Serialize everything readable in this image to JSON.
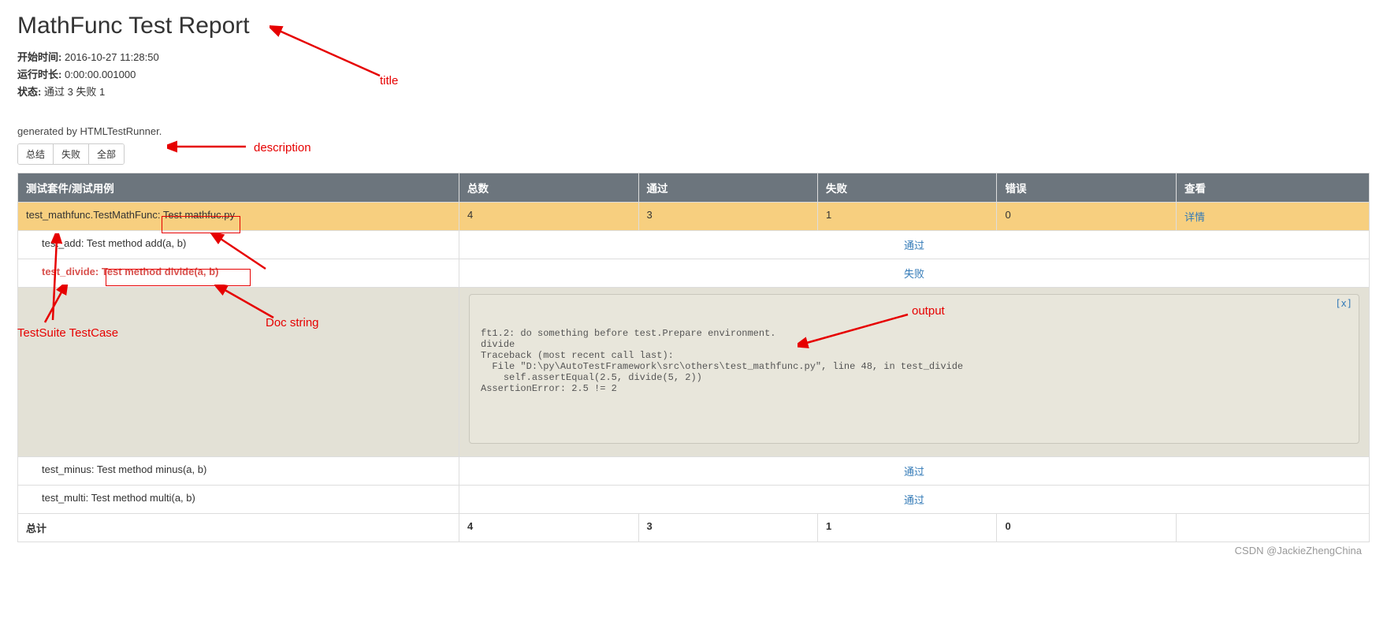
{
  "title": "MathFunc Test Report",
  "meta": {
    "start_label": "开始时间:",
    "start_value": "2016-10-27 11:28:50",
    "duration_label": "运行时长:",
    "duration_value": "0:00:00.001000",
    "status_label": "状态:",
    "status_value": "通过 3 失败 1"
  },
  "description": "generated by HTMLTestRunner.",
  "filters": {
    "summary": "总结",
    "fail": "失败",
    "all": "全部"
  },
  "headers": {
    "suite": "测试套件/测试用例",
    "total": "总数",
    "pass": "通过",
    "fail": "失败",
    "error": "错误",
    "view": "查看"
  },
  "suite": {
    "name": "test_mathfunc.TestMathFunc: Test mathfuc.py",
    "total": "4",
    "pass": "3",
    "fail": "1",
    "error": "0",
    "detail": "详情"
  },
  "cases": {
    "add": {
      "name": "test_add: Test method add(a, b)",
      "status": "通过"
    },
    "divide": {
      "name": "test_divide: Test method divide(a, b)",
      "status": "失败"
    },
    "minus": {
      "name": "test_minus: Test method minus(a, b)",
      "status": "通过"
    },
    "multi": {
      "name": "test_multi: Test method multi(a, b)",
      "status": "通过"
    }
  },
  "close_label": "[x]",
  "output": "ft1.2: do something before test.Prepare environment.\ndivide\nTraceback (most recent call last):\n  File \"D:\\py\\AutoTestFramework\\src\\others\\test_mathfunc.py\", line 48, in test_divide\n    self.assertEqual(2.5, divide(5, 2))\nAssertionError: 2.5 != 2",
  "footer": {
    "label": "总计",
    "total": "4",
    "pass": "3",
    "fail": "1",
    "error": "0"
  },
  "annotations": {
    "title": "title",
    "description": "description",
    "testsuite": "TestSuite TestCase",
    "docstring": "Doc string",
    "output": "output"
  },
  "watermark": "CSDN @JackieZhengChina"
}
